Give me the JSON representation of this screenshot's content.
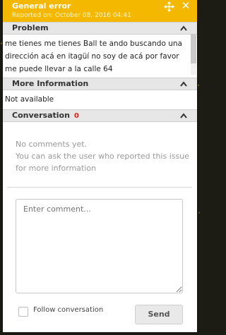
{
  "window": {
    "title": "General error",
    "reported_on": "Reported on: October 08, 2016 04:41"
  },
  "sections": {
    "problem": {
      "title": "Problem",
      "text": "me tienes me tienes Ball te ando buscando una dirección acá en itagüí no soy de acá por favor me puede llevar a la calle 64"
    },
    "more_info": {
      "title": "More Information",
      "text": "Not available"
    },
    "conversation": {
      "title": "Conversation",
      "count": "0",
      "empty_line1": "No comments yet.",
      "empty_line2": "You can ask the user who reported this issue for more information"
    }
  },
  "composer": {
    "placeholder": "Enter comment...",
    "follow_label": "Follow conversation",
    "send_label": "Send"
  },
  "colors": {
    "accent": "#f5b800",
    "badge": "#e0271e",
    "section_header": "#e6e6e6"
  },
  "icons": [
    "move-icon",
    "close-icon",
    "chevron-up-icon"
  ]
}
